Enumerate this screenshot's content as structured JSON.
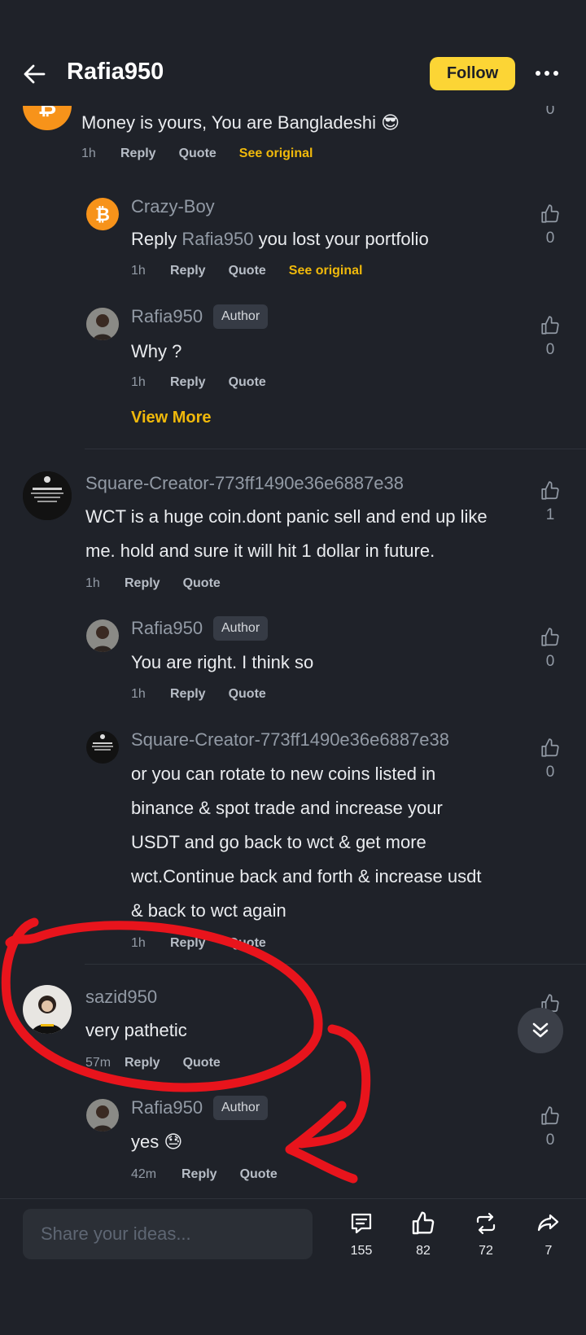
{
  "header": {
    "title": "Rafia950",
    "follow_label": "Follow"
  },
  "actions": {
    "reply": "Reply",
    "quote": "Quote",
    "see_original": "See original",
    "author_badge": "Author",
    "view_more": "View More"
  },
  "comments": {
    "c0": {
      "text": "Money is yours, You are Bangladeshi 😎",
      "time": "1h",
      "likes": "0"
    },
    "c1": {
      "user": "Crazy-Boy",
      "reply_word": "Reply",
      "mention": "Rafia950",
      "text": " you lost your portfolio",
      "time": "1h",
      "likes": "0"
    },
    "c2": {
      "user": "Rafia950",
      "text": "Why ?",
      "time": "1h",
      "likes": "0"
    },
    "c3": {
      "user": "Square-Creator-773ff1490e36e6887e38",
      "line1": "WCT is a huge coin.dont panic sell and end up like",
      "line2": "me. hold and sure it will hit 1 dollar in future.",
      "time": "1h",
      "likes": "1"
    },
    "c4": {
      "user": "Rafia950",
      "text": "You are right. I think so",
      "time": "1h",
      "likes": "0"
    },
    "c5": {
      "user": "Square-Creator-773ff1490e36e6887e38",
      "line1": "or you can rotate to new coins listed in",
      "line2": "binance & spot trade and increase your",
      "line3": "USDT and go back to wct & get more",
      "line4": "wct.Continue back and forth & increase usdt",
      "line5": "& back to wct again",
      "time": "1h",
      "likes": "0"
    },
    "c6": {
      "user": "sazid950",
      "text": "very pathetic",
      "time": "57m"
    },
    "c7": {
      "user": "Rafia950",
      "text": "yes 😓",
      "time": "42m",
      "likes": "0"
    }
  },
  "bottom": {
    "placeholder": "Share your ideas...",
    "comments": "155",
    "likes": "82",
    "reposts": "72",
    "shares": "7"
  },
  "colors": {
    "accent": "#fcd535",
    "link": "#f0b90b",
    "background": "#1f2229",
    "annotation": "#e8141c"
  },
  "icons": [
    "back-arrow-icon",
    "more-icon",
    "thumbs-up-icon",
    "comment-icon",
    "repost-icon",
    "share-icon",
    "double-chevron-down-icon",
    "bitcoin-icon"
  ]
}
